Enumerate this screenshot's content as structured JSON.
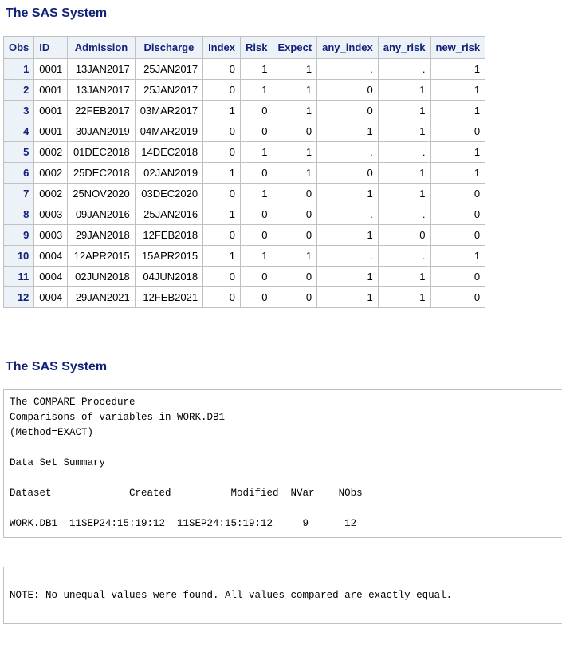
{
  "titles": [
    "The SAS System",
    "The SAS System"
  ],
  "table": {
    "headers": [
      "Obs",
      "ID",
      "Admission",
      "Discharge",
      "Index",
      "Risk",
      "Expect",
      "any_index",
      "any_risk",
      "new_risk"
    ],
    "rows": [
      [
        "1",
        "0001",
        "13JAN2017",
        "25JAN2017",
        "0",
        "1",
        "1",
        ".",
        ".",
        "1"
      ],
      [
        "2",
        "0001",
        "13JAN2017",
        "25JAN2017",
        "0",
        "1",
        "1",
        "0",
        "1",
        "1"
      ],
      [
        "3",
        "0001",
        "22FEB2017",
        "03MAR2017",
        "1",
        "0",
        "1",
        "0",
        "1",
        "1"
      ],
      [
        "4",
        "0001",
        "30JAN2019",
        "04MAR2019",
        "0",
        "0",
        "0",
        "1",
        "1",
        "0"
      ],
      [
        "5",
        "0002",
        "01DEC2018",
        "14DEC2018",
        "0",
        "1",
        "1",
        ".",
        ".",
        "1"
      ],
      [
        "6",
        "0002",
        "25DEC2018",
        "02JAN2019",
        "1",
        "0",
        "1",
        "0",
        "1",
        "1"
      ],
      [
        "7",
        "0002",
        "25NOV2020",
        "03DEC2020",
        "0",
        "1",
        "0",
        "1",
        "1",
        "0"
      ],
      [
        "8",
        "0003",
        "09JAN2016",
        "25JAN2016",
        "1",
        "0",
        "0",
        ".",
        ".",
        "0"
      ],
      [
        "9",
        "0003",
        "29JAN2018",
        "12FEB2018",
        "0",
        "0",
        "0",
        "1",
        "0",
        "0"
      ],
      [
        "10",
        "0004",
        "12APR2015",
        "15APR2015",
        "1",
        "1",
        "1",
        ".",
        ".",
        "1"
      ],
      [
        "11",
        "0004",
        "02JUN2018",
        "04JUN2018",
        "0",
        "0",
        "0",
        "1",
        "1",
        "0"
      ],
      [
        "12",
        "0004",
        "29JAN2021",
        "12FEB2021",
        "0",
        "0",
        "0",
        "1",
        "1",
        "0"
      ]
    ]
  },
  "compare": {
    "lines": [
      "The COMPARE Procedure",
      "Comparisons of variables in WORK.DB1",
      "(Method=EXACT)",
      "",
      "Data Set Summary",
      "",
      "Dataset             Created          Modified  NVar    NObs",
      "",
      "WORK.DB1  11SEP24:15:19:12  11SEP24:15:19:12     9      12"
    ]
  },
  "note": "NOTE: No unequal values were found. All values compared are exactly equal."
}
